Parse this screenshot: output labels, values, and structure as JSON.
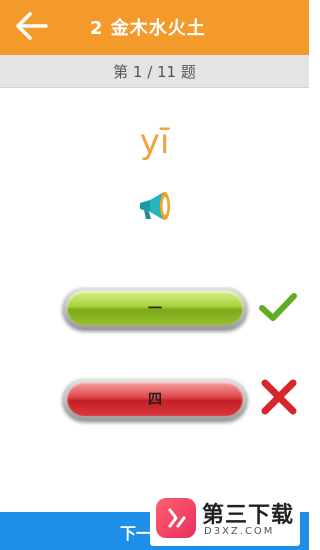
{
  "header": {
    "title": "2 金木水火土",
    "back_icon": "arrow-left-icon",
    "background": "#f39a2b"
  },
  "quiz": {
    "counter": "第 1 / 11 题",
    "pinyin": "yī",
    "speaker_icon": "megaphone-icon"
  },
  "options": [
    {
      "label": "一",
      "color": "green",
      "status": "correct"
    },
    {
      "label": "四",
      "color": "red",
      "status": "wrong"
    }
  ],
  "footer": {
    "next_label": "下一",
    "background": "#1e90ea"
  },
  "watermark": {
    "text": "第三下载",
    "sub": "D3XZ.COM"
  }
}
